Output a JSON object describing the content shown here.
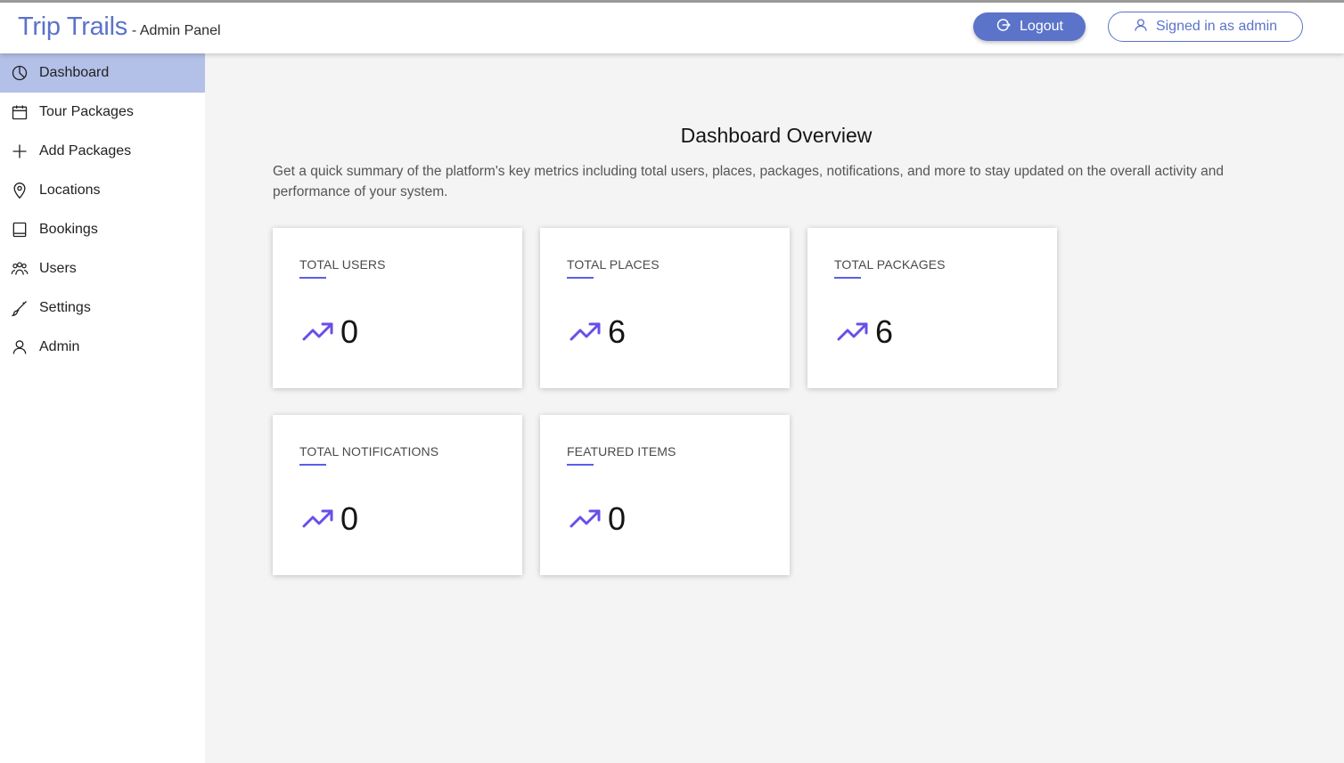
{
  "header": {
    "brand_name": "Trip Trails",
    "brand_sub": "- Admin Panel",
    "logout_label": "Logout",
    "signed_in_label": "Signed in as admin"
  },
  "sidebar": {
    "items": [
      {
        "label": "Dashboard",
        "icon": "pie-chart-icon",
        "active": true
      },
      {
        "label": "Tour Packages",
        "icon": "calendar-icon",
        "active": false
      },
      {
        "label": "Add Packages",
        "icon": "plus-icon",
        "active": false
      },
      {
        "label": "Locations",
        "icon": "location-pin-icon",
        "active": false
      },
      {
        "label": "Bookings",
        "icon": "book-icon",
        "active": false
      },
      {
        "label": "Users",
        "icon": "users-icon",
        "active": false
      },
      {
        "label": "Settings",
        "icon": "brush-icon",
        "active": false
      },
      {
        "label": "Admin",
        "icon": "user-icon",
        "active": false
      }
    ]
  },
  "main": {
    "title": "Dashboard Overview",
    "description": "Get a quick summary of the platform's key metrics including total users, places, packages, notifications, and more to stay updated on the overall activity and performance of your system.",
    "cards": [
      {
        "label": "TOTAL USERS",
        "value": "0"
      },
      {
        "label": "TOTAL PLACES",
        "value": "6"
      },
      {
        "label": "TOTAL PACKAGES",
        "value": "6"
      },
      {
        "label": "TOTAL NOTIFICATIONS",
        "value": "0"
      },
      {
        "label": "FEATURED ITEMS",
        "value": "0"
      }
    ]
  },
  "colors": {
    "brand": "#5b73c9",
    "active_nav": "#b3c0e8",
    "accent_line": "#5b5ee8",
    "trend_icon": "#6a4ee8"
  }
}
